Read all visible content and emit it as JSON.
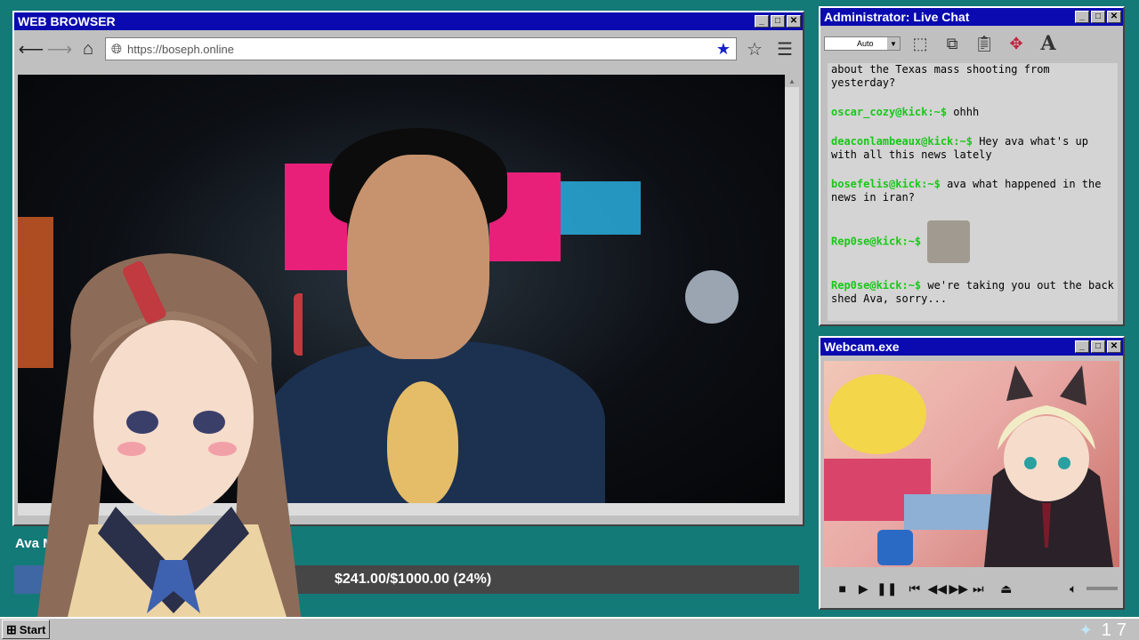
{
  "browser": {
    "title": "WEB BROWSER",
    "url": "https://boseph.online"
  },
  "stream": {
    "label": "Ava M",
    "progress_text": "$241.00/$1000.00 (24%)",
    "progress_fraction": 0.24
  },
  "chat": {
    "title": "Administrator: Live Chat",
    "select_value": "Auto",
    "messages": [
      {
        "user": "",
        "text": "about the Texas mass shooting from yesterday?"
      },
      {
        "user": "oscar_cozy@kick:~$",
        "text": "ohhh"
      },
      {
        "user": "deaconlambeaux@kick:~$",
        "text": "Hey ava what's up with all this news lately"
      },
      {
        "user": "bosefelis@kick:~$",
        "text": "ava what happened in the news in iran?"
      },
      {
        "user": "Rep0se@kick:~$",
        "text": ""
      },
      {
        "user": "Rep0se@kick:~$",
        "text": "we're taking you out the back shed Ava, sorry..."
      }
    ]
  },
  "webcam": {
    "title": "Webcam.exe"
  },
  "taskbar": {
    "start_label": "Start",
    "clock": "17"
  },
  "colors": {
    "desktop": "#137a78",
    "titlebar": "#0a0ab0",
    "chat_user": "#18c818",
    "progress_fill": "#3f67a3"
  }
}
